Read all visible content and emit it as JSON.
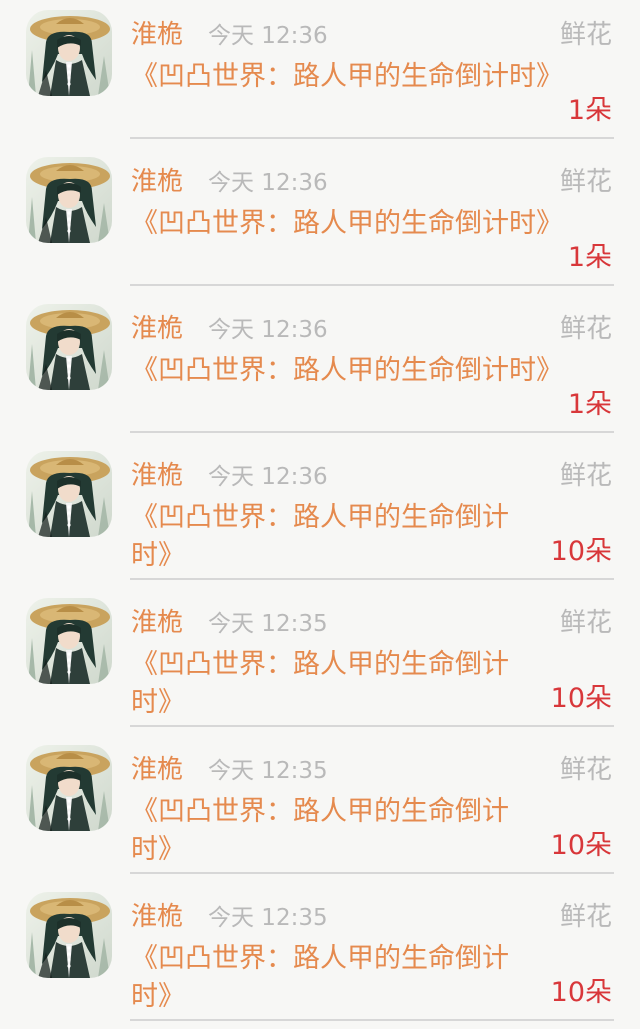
{
  "items": [
    {
      "name": "淮桅",
      "time": "今天 12:36",
      "gift_type": "鲜花",
      "title": "《凹凸世界：路人甲的生命倒计时》",
      "count": "1朵"
    },
    {
      "name": "淮桅",
      "time": "今天 12:36",
      "gift_type": "鲜花",
      "title": "《凹凸世界：路人甲的生命倒计时》",
      "count": "1朵"
    },
    {
      "name": "淮桅",
      "time": "今天 12:36",
      "gift_type": "鲜花",
      "title": "《凹凸世界：路人甲的生命倒计时》",
      "count": "1朵"
    },
    {
      "name": "淮桅",
      "time": "今天 12:36",
      "gift_type": "鲜花",
      "title": "《凹凸世界：路人甲的生命倒计时》",
      "count": "10朵"
    },
    {
      "name": "淮桅",
      "time": "今天 12:35",
      "gift_type": "鲜花",
      "title": "《凹凸世界：路人甲的生命倒计时》",
      "count": "10朵"
    },
    {
      "name": "淮桅",
      "time": "今天 12:35",
      "gift_type": "鲜花",
      "title": "《凹凸世界：路人甲的生命倒计时》",
      "count": "10朵"
    },
    {
      "name": "淮桅",
      "time": "今天 12:35",
      "gift_type": "鲜花",
      "title": "《凹凸世界：路人甲的生命倒计时》",
      "count": "10朵"
    }
  ],
  "colors": {
    "accent": "#e58a4e",
    "muted": "#b9b9b9",
    "count": "#d8373a",
    "divider": "#d7d7d7",
    "background": "#f7f7f5"
  },
  "icons": {
    "avatar": "user-avatar-image"
  }
}
